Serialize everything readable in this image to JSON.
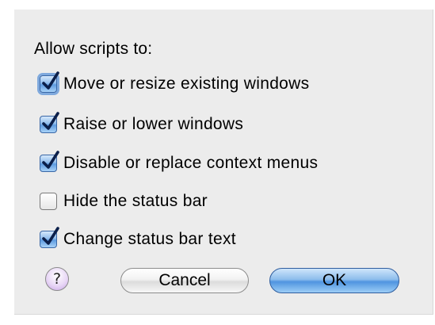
{
  "dialog": {
    "heading": "Allow scripts to:",
    "options": [
      {
        "label": "Move or resize existing windows",
        "checked": true
      },
      {
        "label": "Raise or lower windows",
        "checked": true
      },
      {
        "label": "Disable or replace context menus",
        "checked": true
      },
      {
        "label": "Hide the status bar",
        "checked": false
      },
      {
        "label": "Change status bar text",
        "checked": true
      }
    ],
    "help_glyph": "?",
    "cancel_label": "Cancel",
    "ok_label": "OK"
  },
  "colors": {
    "panel_background": "#ececec",
    "checkbox_accent": "#5d9be0",
    "default_button": "#4f94e0",
    "help_button": "#c7a4e6"
  }
}
